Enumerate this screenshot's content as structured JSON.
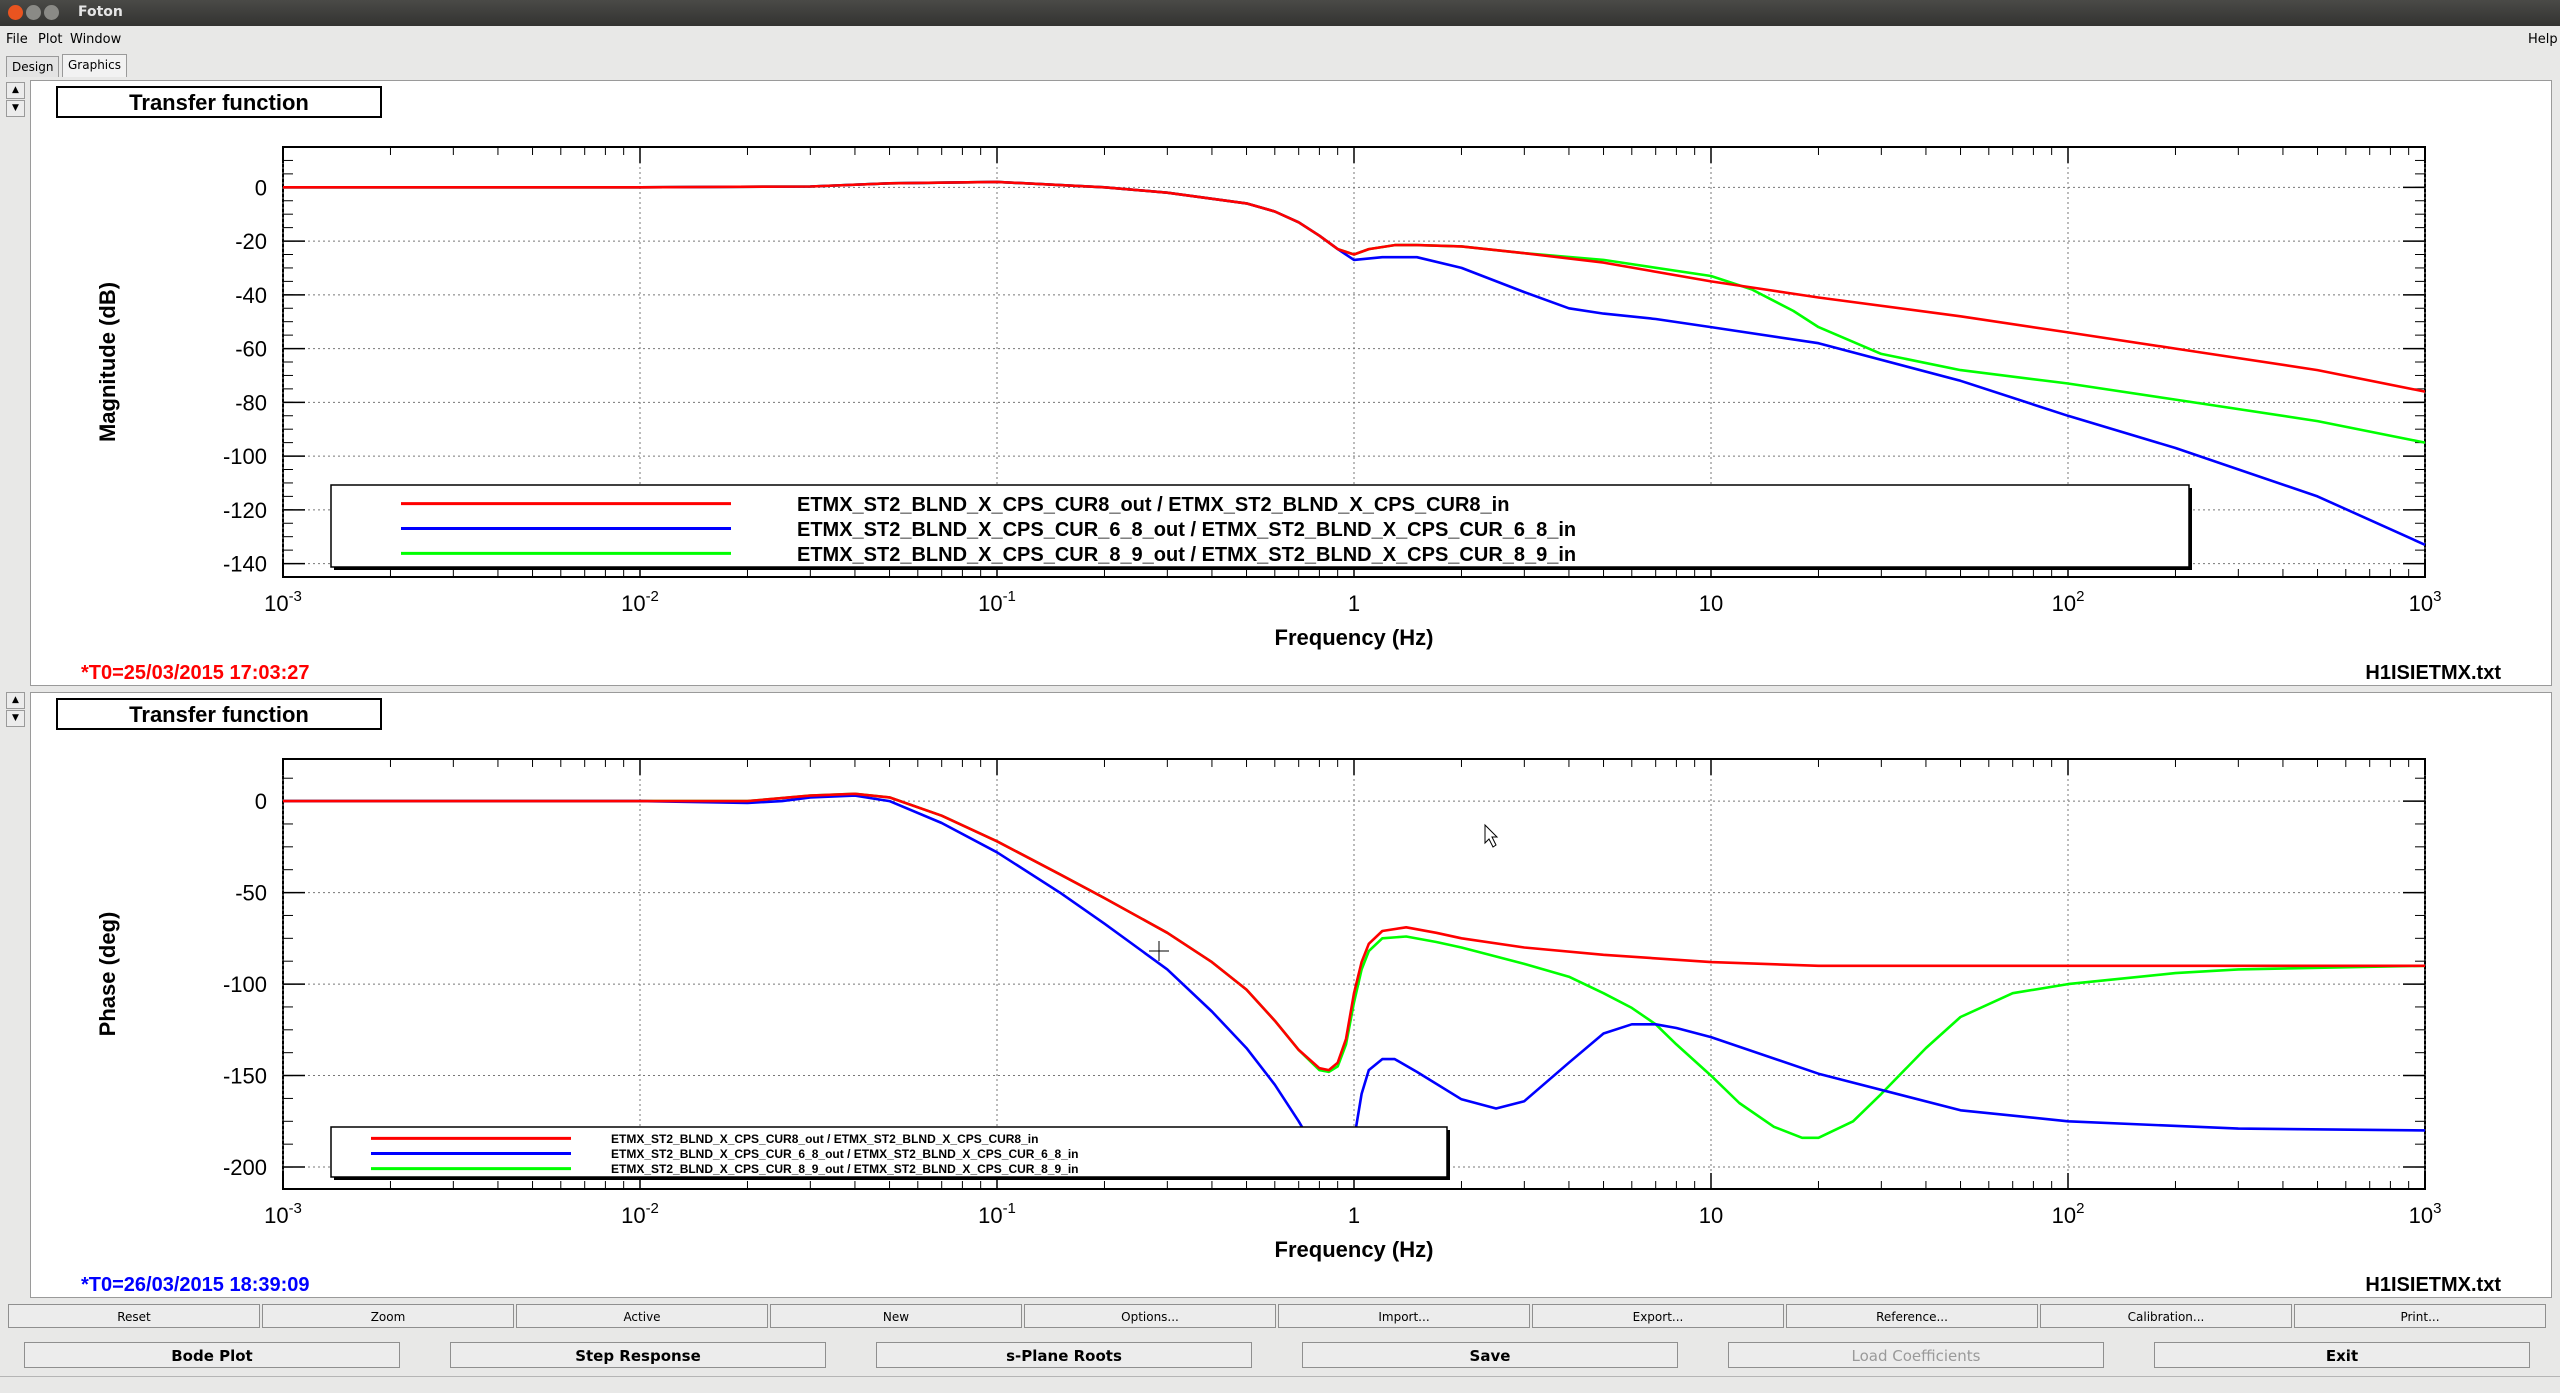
{
  "window": {
    "title": "Foton"
  },
  "menu": {
    "file": "File",
    "plot": "Plot",
    "window": "Window",
    "help": "Help"
  },
  "tabs": [
    {
      "label": "Design"
    },
    {
      "label": "Graphics"
    }
  ],
  "colors": {
    "red": "#ff0000",
    "blue": "#0000ff",
    "green": "#00ff00",
    "t0_top": "#ff0000",
    "t0_bottom": "#0000ff"
  },
  "plots": [
    {
      "title": "Transfer function",
      "t0": "*T0=25/03/2015 17:03:27",
      "filename": "H1ISIETMX.txt"
    },
    {
      "title": "Transfer function",
      "t0": "*T0=26/03/2015 18:39:09",
      "filename": "H1ISIETMX.txt"
    }
  ],
  "chart_data": [
    {
      "type": "line",
      "title": "Transfer function",
      "xlabel": "Frequency (Hz)",
      "ylabel": "Magnitude (dB)",
      "xscale": "log",
      "xlim": [
        0.001,
        1000
      ],
      "ylim": [
        -145,
        15
      ],
      "xticks": [
        0.001,
        0.01,
        0.1,
        1,
        10,
        100,
        1000
      ],
      "xtick_labels": [
        {
          "base": "10",
          "exp": "-3"
        },
        {
          "base": "10",
          "exp": "-2"
        },
        {
          "base": "10",
          "exp": "-1"
        },
        {
          "base": "1",
          "exp": ""
        },
        {
          "base": "10",
          "exp": ""
        },
        {
          "base": "10",
          "exp": "2"
        },
        {
          "base": "10",
          "exp": "3"
        }
      ],
      "yticks": [
        0,
        -20,
        -40,
        -60,
        -80,
        -100,
        -120,
        -140
      ],
      "ytick_labels": [
        "0",
        "-20",
        "-40",
        "-60",
        "-80",
        "-100",
        "-120",
        "-140"
      ],
      "grid": true,
      "legend_position": "bottom-center",
      "series": [
        {
          "name": "ETMX_ST2_BLND_X_CPS_CUR8_out / ETMX_ST2_BLND_X_CPS_CUR8_in",
          "color": "#ff0000",
          "x": [
            0.001,
            0.01,
            0.03,
            0.05,
            0.1,
            0.2,
            0.3,
            0.5,
            0.6,
            0.7,
            0.8,
            0.9,
            1.0,
            1.1,
            1.3,
            1.5,
            2,
            3,
            5,
            10,
            20,
            50,
            100,
            200,
            500,
            1000
          ],
          "y": [
            0,
            0,
            0.3,
            1.5,
            2,
            0,
            -2,
            -6,
            -9,
            -13,
            -18,
            -23,
            -25,
            -23,
            -21.5,
            -21.5,
            -22,
            -24.5,
            -28,
            -35,
            -41,
            -48,
            -54,
            -60,
            -68,
            -76
          ]
        },
        {
          "name": "ETMX_ST2_BLND_X_CPS_CUR_6_8_out / ETMX_ST2_BLND_X_CPS_CUR_6_8_in",
          "color": "#0000ff",
          "x": [
            0.001,
            0.01,
            0.03,
            0.05,
            0.1,
            0.2,
            0.3,
            0.5,
            0.6,
            0.7,
            0.8,
            0.9,
            1.0,
            1.2,
            1.5,
            2,
            3,
            4,
            5,
            7,
            10,
            20,
            50,
            100,
            200,
            500,
            1000
          ],
          "y": [
            0,
            0,
            0.3,
            1.5,
            2,
            0,
            -2,
            -6,
            -9,
            -13,
            -18,
            -23,
            -27,
            -26,
            -26,
            -30,
            -39,
            -45,
            -47,
            -49,
            -52,
            -58,
            -72,
            -85,
            -97,
            -115,
            -133
          ]
        },
        {
          "name": "ETMX_ST2_BLND_X_CPS_CUR_8_9_out / ETMX_ST2_BLND_X_CPS_CUR_8_9_in",
          "color": "#00ff00",
          "x": [
            0.001,
            0.01,
            0.03,
            0.05,
            0.1,
            0.2,
            0.3,
            0.5,
            0.6,
            0.7,
            0.8,
            0.9,
            1.0,
            1.1,
            1.3,
            1.5,
            2,
            3,
            5,
            10,
            13,
            17,
            20,
            30,
            50,
            100,
            200,
            500,
            1000
          ],
          "y": [
            0,
            0,
            0.3,
            1.5,
            2,
            0,
            -2,
            -6,
            -9,
            -13,
            -18,
            -23,
            -25,
            -23,
            -21.5,
            -21.5,
            -22,
            -24.5,
            -27,
            -33,
            -38,
            -46,
            -52,
            -62,
            -68,
            -73,
            -79,
            -87,
            -95
          ]
        }
      ]
    },
    {
      "type": "line",
      "title": "Transfer function",
      "xlabel": "Frequency (Hz)",
      "ylabel": "Phase (deg)",
      "xscale": "log",
      "xlim": [
        0.001,
        1000
      ],
      "ylim": [
        -212,
        23
      ],
      "xticks": [
        0.001,
        0.01,
        0.1,
        1,
        10,
        100,
        1000
      ],
      "xtick_labels": [
        {
          "base": "10",
          "exp": "-3"
        },
        {
          "base": "10",
          "exp": "-2"
        },
        {
          "base": "10",
          "exp": "-1"
        },
        {
          "base": "1",
          "exp": ""
        },
        {
          "base": "10",
          "exp": ""
        },
        {
          "base": "10",
          "exp": "2"
        },
        {
          "base": "10",
          "exp": "3"
        }
      ],
      "yticks": [
        0,
        -50,
        -100,
        -150,
        -200
      ],
      "ytick_labels": [
        "0",
        "-50",
        "-100",
        "-150",
        "-200"
      ],
      "grid": true,
      "legend_position": "bottom-left",
      "series": [
        {
          "name": "ETMX_ST2_BLND_X_CPS_CUR8_out / ETMX_ST2_BLND_X_CPS_CUR8_in",
          "color": "#ff0000",
          "x": [
            0.001,
            0.01,
            0.02,
            0.03,
            0.04,
            0.05,
            0.07,
            0.1,
            0.15,
            0.2,
            0.3,
            0.4,
            0.5,
            0.6,
            0.7,
            0.8,
            0.85,
            0.9,
            0.95,
            1.0,
            1.05,
            1.1,
            1.2,
            1.4,
            1.7,
            2,
            3,
            5,
            10,
            20,
            50,
            100,
            300,
            1000
          ],
          "y": [
            0,
            0,
            0,
            3,
            4,
            2,
            -8,
            -22,
            -40,
            -53,
            -72,
            -88,
            -103,
            -120,
            -136,
            -146,
            -147,
            -143,
            -130,
            -105,
            -88,
            -78,
            -71,
            -69,
            -72,
            -75,
            -80,
            -84,
            -88,
            -90,
            -90,
            -90,
            -90,
            -90
          ]
        },
        {
          "name": "ETMX_ST2_BLND_X_CPS_CUR_6_8_out / ETMX_ST2_BLND_X_CPS_CUR_6_8_in",
          "color": "#0000ff",
          "x": [
            0.001,
            0.01,
            0.02,
            0.025,
            0.03,
            0.04,
            0.05,
            0.07,
            0.1,
            0.15,
            0.2,
            0.3,
            0.4,
            0.5,
            0.6,
            0.7,
            0.75,
            0.8
          ],
          "y": [
            0,
            0,
            -1,
            0,
            2,
            3,
            0,
            -12,
            -28,
            -50,
            -67,
            -92,
            -115,
            -135,
            -155,
            -175,
            -185,
            -193
          ],
          "x2": [
            0.95,
            1.0,
            1.05,
            1.1,
            1.2,
            1.3,
            1.5,
            2,
            2.5,
            3,
            4,
            5,
            6,
            7,
            8,
            10,
            20,
            50,
            100,
            300,
            1000
          ],
          "y2": [
            -205,
            -185,
            -160,
            -147,
            -141,
            -141,
            -148,
            -163,
            -168,
            -164,
            -143,
            -127,
            -122,
            -122,
            -124,
            -129,
            -149,
            -169,
            -175,
            -179,
            -180
          ]
        },
        {
          "name": "ETMX_ST2_BLND_X_CPS_CUR_8_9_out / ETMX_ST2_BLND_X_CPS_CUR_8_9_in",
          "color": "#00ff00",
          "x": [
            0.001,
            0.01,
            0.02,
            0.03,
            0.04,
            0.05,
            0.07,
            0.1,
            0.15,
            0.2,
            0.3,
            0.4,
            0.5,
            0.6,
            0.7,
            0.8,
            0.85,
            0.9,
            0.95,
            1.0,
            1.05,
            1.1,
            1.2,
            1.4,
            1.7,
            2,
            3,
            4,
            5,
            6,
            7,
            8,
            10,
            12,
            15,
            18,
            20,
            25,
            30,
            40,
            50,
            70,
            100,
            200,
            300,
            1000
          ],
          "y": [
            0,
            0,
            0,
            3,
            4,
            2,
            -8,
            -22,
            -40,
            -53,
            -72,
            -88,
            -103,
            -120,
            -136,
            -147,
            -148,
            -145,
            -133,
            -110,
            -92,
            -82,
            -75,
            -74,
            -77,
            -80,
            -89,
            -96,
            -105,
            -113,
            -122,
            -133,
            -150,
            -165,
            -178,
            -184,
            -184,
            -175,
            -160,
            -135,
            -118,
            -105,
            -100,
            -94,
            -92,
            -90
          ]
        }
      ]
    }
  ],
  "buttons_row1": [
    "Reset",
    "Zoom",
    "Active",
    "New",
    "Options...",
    "Import...",
    "Export...",
    "Reference...",
    "Calibration...",
    "Print..."
  ],
  "buttons_row2": [
    {
      "label": "Bode Plot",
      "enabled": true
    },
    {
      "label": "Step Response",
      "enabled": true
    },
    {
      "label": "s-Plane Roots",
      "enabled": true
    },
    {
      "label": "Save",
      "enabled": true
    },
    {
      "label": "Load Coefficients",
      "enabled": false
    },
    {
      "label": "Exit",
      "enabled": true
    }
  ]
}
